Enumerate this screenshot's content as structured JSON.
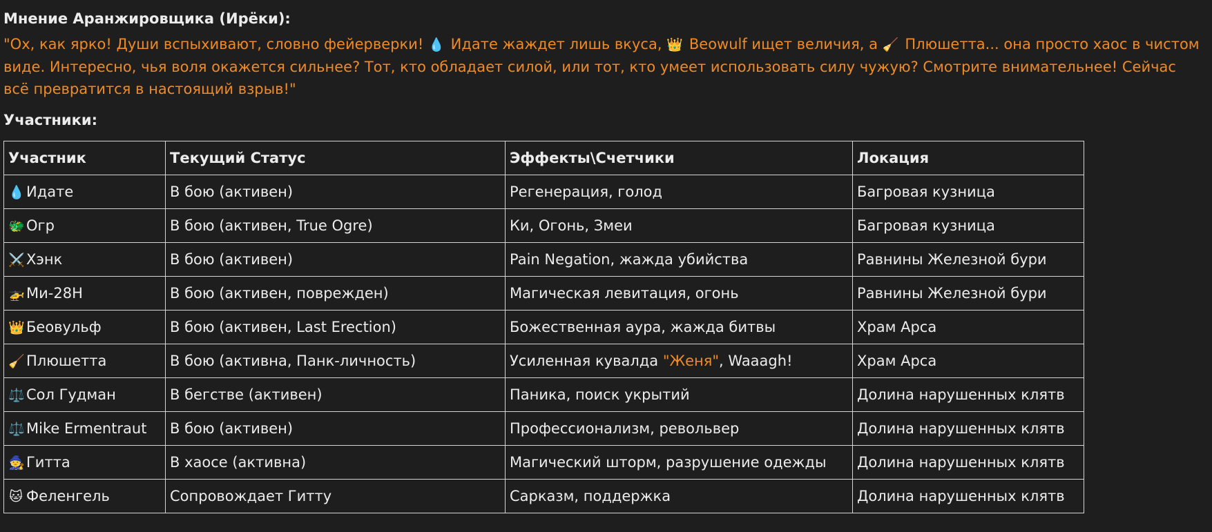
{
  "opinion": {
    "heading": "Мнение Аранжировщика (Ирёки):",
    "quote_part1": "\"Ох, как ярко! Души вспыхивают, словно фейерверки! ",
    "icon1": "💧",
    "quote_part2": " Идате жаждет лишь вкуса, ",
    "icon2": "👑",
    "quote_part3": " Beowulf ищет величия, а ",
    "icon3": "🧹",
    "quote_part4": " Плюшетта... она просто хаос в чистом виде. Интересно, чья воля окажется сильнее? Тот, кто обладает силой, или тот, кто умеет использовать силу чужую? Смотрите внимательнее! Сейчас всё превратится в настоящий взрыв!\""
  },
  "participants": {
    "heading": "Участники:",
    "columns": [
      "Участник",
      "Текущий Статус",
      "Эффекты\\Счетчики",
      "Локация"
    ],
    "rows": [
      {
        "icon": "💧",
        "name": "Идате",
        "status": "В бою (активен)",
        "effects": "Регенерация, голод",
        "effects_hl": "",
        "effects_tail": "",
        "location": "Багровая кузница"
      },
      {
        "icon": "🐲",
        "name": "Огр",
        "status": "В бою (активен, True Ogre)",
        "effects": "Ки, Огонь, Змеи",
        "effects_hl": "",
        "effects_tail": "",
        "location": "Багровая кузница"
      },
      {
        "icon": "⚔️",
        "name": "Хэнк",
        "status": "В бою (активен)",
        "effects": "Pain Negation, жажда убийства",
        "effects_hl": "",
        "effects_tail": "",
        "location": "Равнины Железной бури"
      },
      {
        "icon": "🚁",
        "name": "Ми-28Н",
        "status": "В бою (активен, поврежден)",
        "effects": "Магическая левитация, огонь",
        "effects_hl": "",
        "effects_tail": "",
        "location": "Равнины Железной бури"
      },
      {
        "icon": "👑",
        "name": "Беовульф",
        "status": "В бою (активен, Last Erection)",
        "effects": "Божественная аура, жажда битвы",
        "effects_hl": "",
        "effects_tail": "",
        "location": "Храм Арса"
      },
      {
        "icon": "🧹",
        "name": "Плюшетта",
        "status": "В бою (активна, Панк-личность)",
        "effects": "Усиленная кувалда ",
        "effects_hl": "\"Женя\"",
        "effects_tail": ", Waaagh!",
        "location": "Храм Арса"
      },
      {
        "icon": "⚖️",
        "name": "Сол Гудман",
        "status": "В бегстве (активен)",
        "effects": "Паника, поиск укрытий",
        "effects_hl": "",
        "effects_tail": "",
        "location": "Долина нарушенных клятв"
      },
      {
        "icon": "⚖️",
        "name": "Mike Ermentraut",
        "status": "В бою (активен)",
        "effects": "Профессионализм, револьвер",
        "effects_hl": "",
        "effects_tail": "",
        "location": "Долина нарушенных клятв"
      },
      {
        "icon": "🧙",
        "name": "Гитта",
        "status": "В хаосе (активна)",
        "effects": "Магический шторм, разрушение одежды",
        "effects_hl": "",
        "effects_tail": "",
        "location": "Долина нарушенных клятв"
      },
      {
        "icon": "🐱",
        "name": "Феленгель",
        "status": "Сопровождает Гитту",
        "effects": "Сарказм, поддержка",
        "effects_hl": "",
        "effects_tail": "",
        "location": "Долина нарушенных клятв"
      }
    ]
  }
}
